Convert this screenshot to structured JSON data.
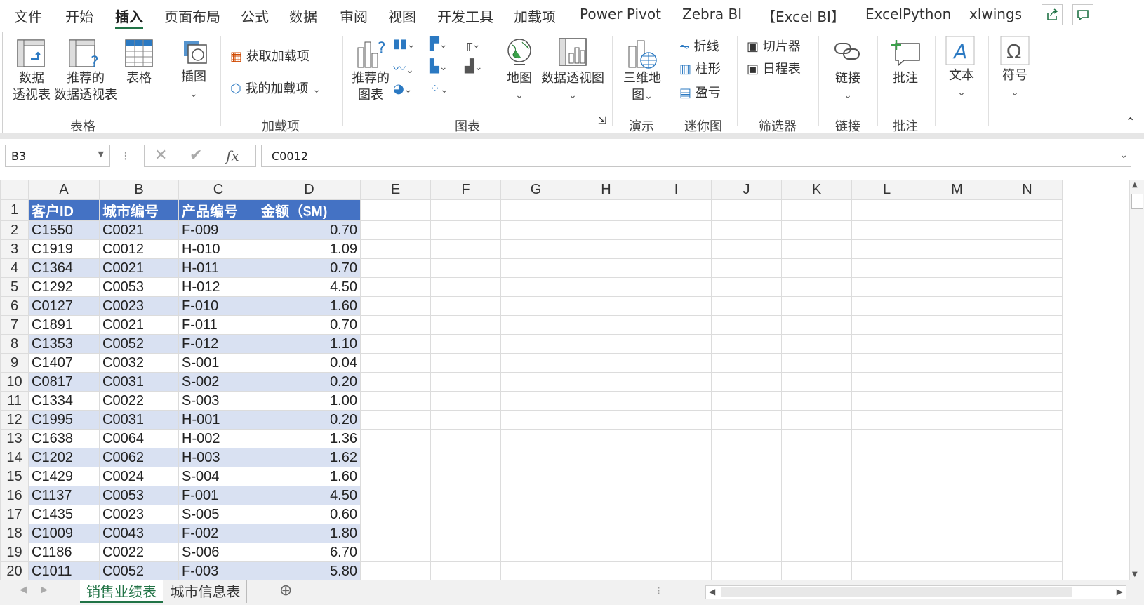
{
  "tabs": [
    "文件",
    "开始",
    "插入",
    "页面布局",
    "公式",
    "数据",
    "审阅",
    "视图",
    "开发工具",
    "加载项",
    "Power Pivot",
    "Zebra BI",
    "【Excel BI】",
    "ExcelPython",
    "xlwings"
  ],
  "active_tab": "插入",
  "ribbon": {
    "groups": {
      "table": "表格",
      "addins": "加载项",
      "charts": "图表",
      "tours": "演示",
      "sparklines": "迷你图",
      "filters": "筛选器",
      "links": "链接",
      "comments": "批注"
    },
    "buttons": {
      "pivot_table_l1": "数据",
      "pivot_table_l2": "透视表",
      "rec_pivot_l1": "推荐的",
      "rec_pivot_l2": "数据透视表",
      "table": "表格",
      "illustrations": "插图",
      "get_addins": "获取加载项",
      "my_addins": "我的加载项",
      "rec_charts_l1": "推荐的",
      "rec_charts_l2": "图表",
      "map": "地图",
      "pivot_chart": "数据透视图",
      "map3d_l1": "三维地",
      "map3d_l2": "图",
      "spark_line": "折线",
      "spark_column": "柱形",
      "spark_winloss": "盈亏",
      "slicer": "切片器",
      "timeline": "日程表",
      "link": "链接",
      "comment": "批注",
      "text": "文本",
      "symbol": "符号"
    }
  },
  "formula_bar": {
    "name_box": "B3",
    "fx": "fx",
    "formula": "C0012"
  },
  "columns": [
    "A",
    "B",
    "C",
    "D",
    "E",
    "F",
    "G",
    "H",
    "I",
    "J",
    "K",
    "L",
    "M",
    "N"
  ],
  "header_row": [
    "客户ID",
    "城市编号",
    "产品编号",
    "金额（$M)"
  ],
  "rows": [
    [
      "C1550",
      "C0021",
      "F-009",
      "0.70"
    ],
    [
      "C1919",
      "C0012",
      "H-010",
      "1.09"
    ],
    [
      "C1364",
      "C0021",
      "H-011",
      "0.70"
    ],
    [
      "C1292",
      "C0053",
      "H-012",
      "4.50"
    ],
    [
      "C0127",
      "C0023",
      "F-010",
      "1.60"
    ],
    [
      "C1891",
      "C0021",
      "F-011",
      "0.70"
    ],
    [
      "C1353",
      "C0052",
      "F-012",
      "1.10"
    ],
    [
      "C1407",
      "C0032",
      "S-001",
      "0.04"
    ],
    [
      "C0817",
      "C0031",
      "S-002",
      "0.20"
    ],
    [
      "C1334",
      "C0022",
      "S-003",
      "1.00"
    ],
    [
      "C1995",
      "C0031",
      "H-001",
      "0.20"
    ],
    [
      "C1638",
      "C0064",
      "H-002",
      "1.36"
    ],
    [
      "C1202",
      "C0062",
      "H-003",
      "1.62"
    ],
    [
      "C1429",
      "C0024",
      "S-004",
      "1.60"
    ],
    [
      "C1137",
      "C0053",
      "F-001",
      "4.50"
    ],
    [
      "C1435",
      "C0023",
      "S-005",
      "0.60"
    ],
    [
      "C1009",
      "C0043",
      "F-002",
      "1.80"
    ],
    [
      "C1186",
      "C0022",
      "S-006",
      "6.70"
    ],
    [
      "C1011",
      "C0052",
      "F-003",
      "5.80"
    ]
  ],
  "sheets": [
    "销售业绩表",
    "城市信息表"
  ],
  "active_sheet": "销售业绩表",
  "colors": {
    "header_fill": "#4472c4",
    "band_fill": "#d9e1f2",
    "accent": "#217346"
  }
}
